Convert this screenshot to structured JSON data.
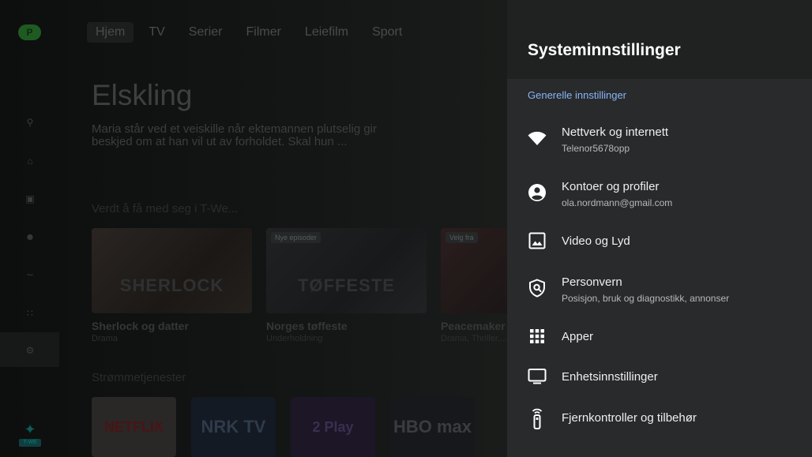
{
  "background": {
    "profile_initial": "P",
    "nav": [
      "Hjem",
      "TV",
      "Serier",
      "Filmer",
      "Leiefilm",
      "Sport"
    ],
    "hero_title": "Elskling",
    "hero_description": "Maria står ved et veiskille når ektemannen plutselig gir beskjed om at han vil ut av forholdet. Skal hun ...",
    "row_title": "Verdt å få med seg i T-We...",
    "cards": [
      {
        "title": "Sherlock og datter",
        "subtitle": "Drama",
        "badge": "",
        "art_text": "SHERLOCK"
      },
      {
        "title": "Norges tøffeste",
        "subtitle": "Underholdning",
        "badge": "Nye episoder",
        "art_text": "TØFFESTE"
      },
      {
        "title": "Peacemaker",
        "subtitle": "Drama, Thriller,...",
        "badge": "Velg fra",
        "art_text": ""
      }
    ],
    "streams_title": "Strømmetjenester",
    "streams": [
      "NETFLIX",
      "NRK TV",
      "2 Play",
      "HBO max"
    ],
    "brand_tag": "T-WE"
  },
  "settings": {
    "title": "Systeminnstillinger",
    "section": "Generelle innstillinger",
    "accent_color": "#8ab4f8",
    "items": [
      {
        "icon": "wifi-icon",
        "label": "Nettverk og internett",
        "sub": "Telenor5678opp"
      },
      {
        "icon": "account-icon",
        "label": "Kontoer og profiler",
        "sub": "ola.nordmann@gmail.com"
      },
      {
        "icon": "image-icon",
        "label": "Video og Lyd",
        "sub": ""
      },
      {
        "icon": "privacy-shield-icon",
        "label": "Personvern",
        "sub": "Posisjon, bruk og diagnostikk, annonser"
      },
      {
        "icon": "apps-grid-icon",
        "label": "Apper",
        "sub": ""
      },
      {
        "icon": "monitor-icon",
        "label": "Enhetsinnstillinger",
        "sub": ""
      },
      {
        "icon": "remote-icon",
        "label": "Fjernkontroller og tilbehør",
        "sub": ""
      }
    ]
  }
}
